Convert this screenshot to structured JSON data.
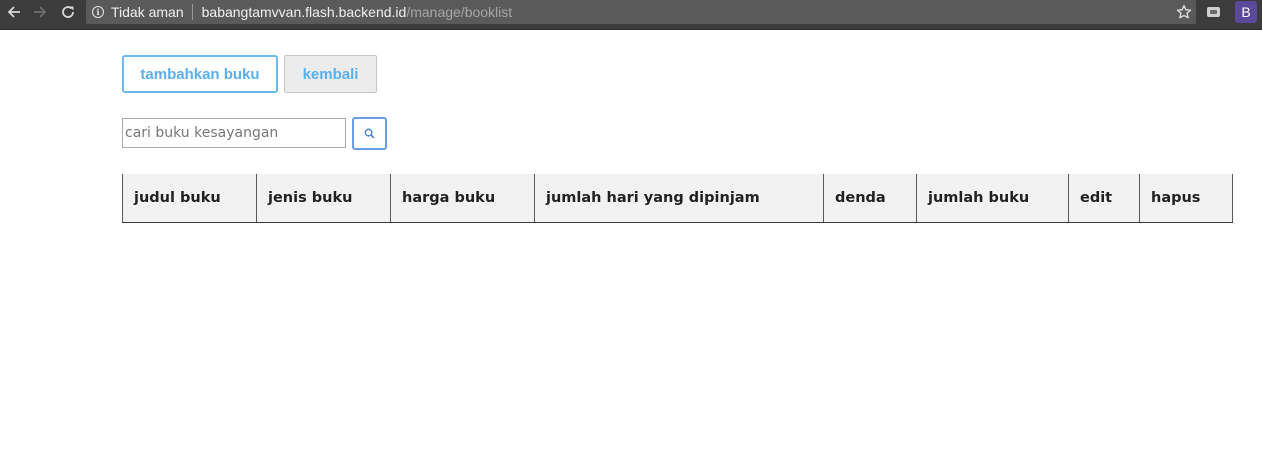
{
  "browser": {
    "security_label": "Tidak aman",
    "url_host": "babangtamvvan.flash.backend.id",
    "url_path": "/manage/booklist",
    "profile_initial": "B",
    "icons": {
      "back": "arrow-left-icon",
      "forward": "arrow-right-icon",
      "reload": "reload-icon",
      "info": "info-icon",
      "bookmark": "star-icon",
      "extension": "extension-icon"
    }
  },
  "toolbar": {
    "add_label": "tambahkan buku",
    "back_label": "kembali"
  },
  "search": {
    "placeholder": "cari buku kesayangan",
    "value": "",
    "icon": "search-icon"
  },
  "table": {
    "columns": [
      "judul buku",
      "jenis buku",
      "harga buku",
      "jumlah hari yang dipinjam",
      "denda",
      "jumlah buku",
      "edit",
      "hapus"
    ],
    "rows": []
  },
  "colors": {
    "accent": "#5ab0ee",
    "chrome_bg": "#3c3c3c",
    "omnibox_bg": "#5a5a5a",
    "header_bg": "#f2f2f2",
    "avatar_bg": "#5b4a9a"
  }
}
